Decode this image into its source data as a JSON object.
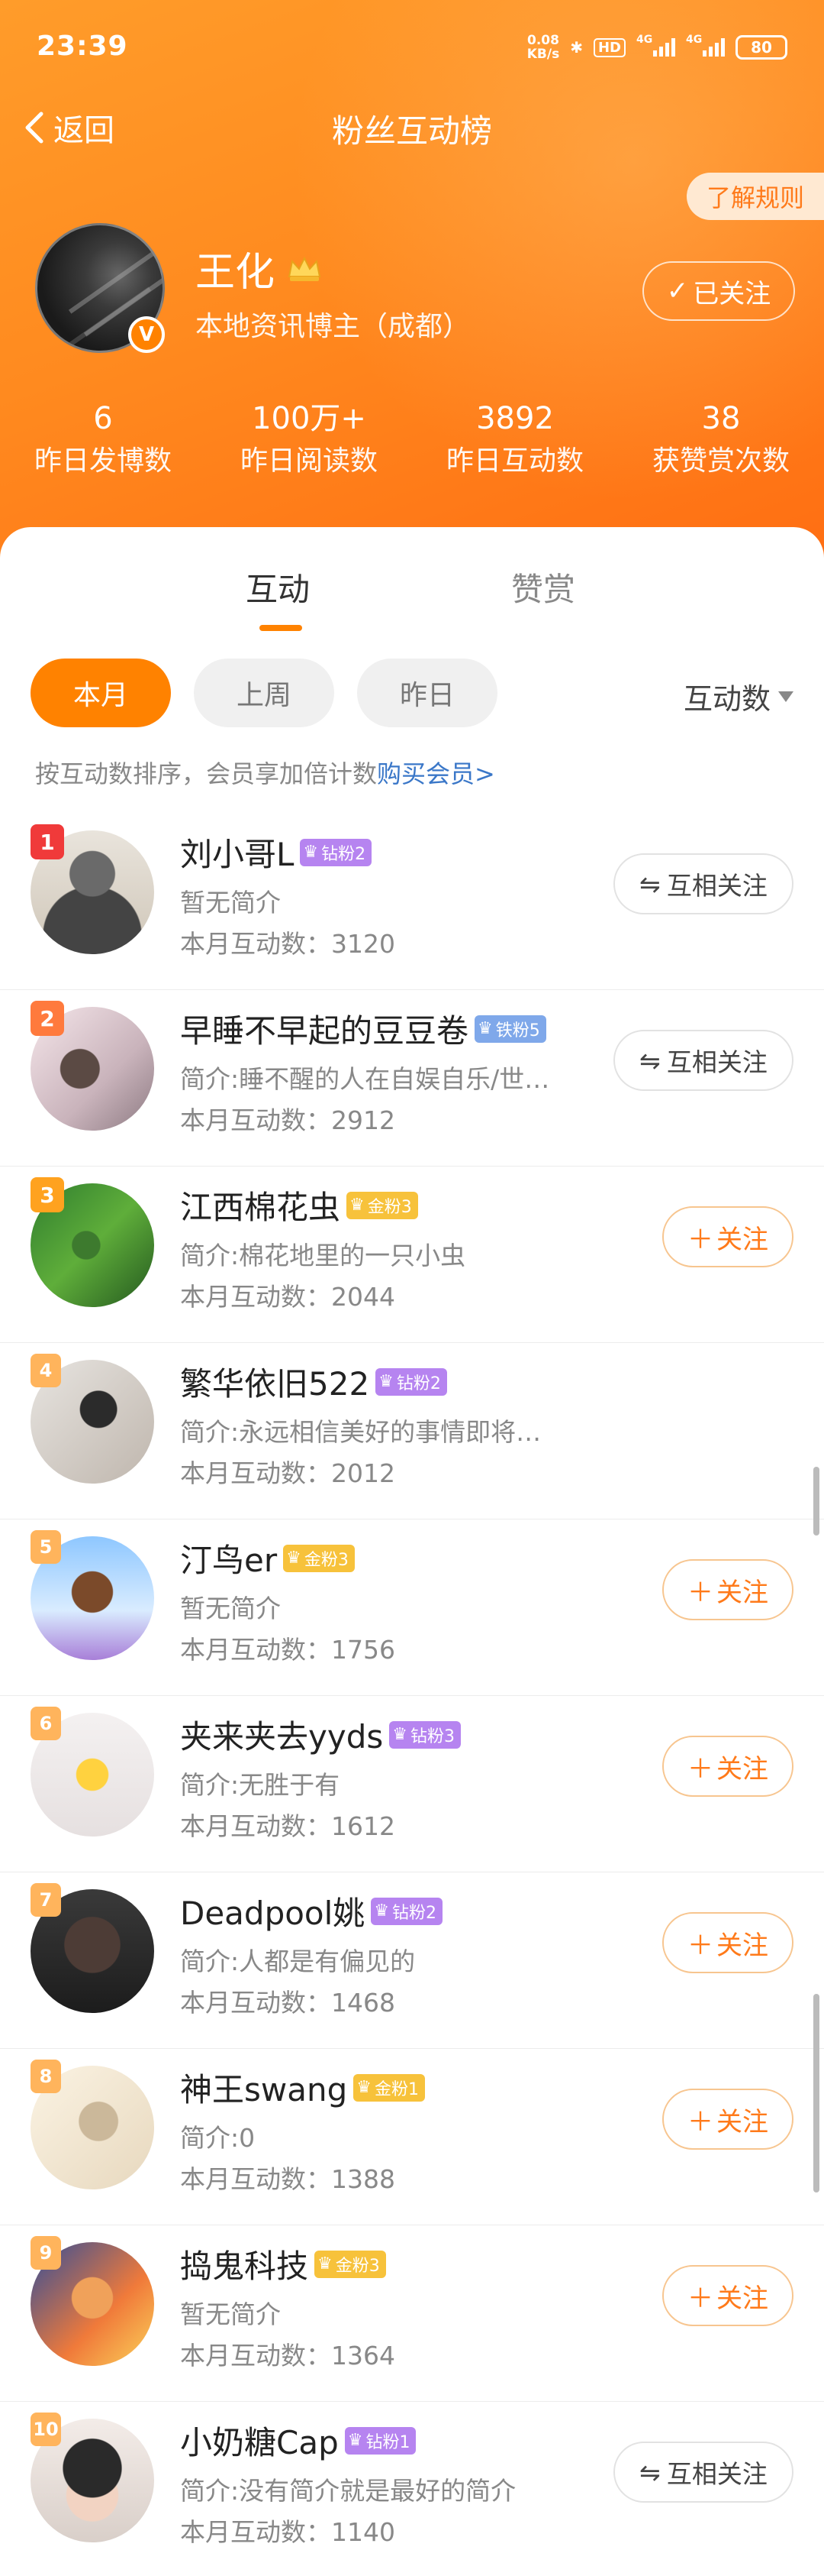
{
  "status_bar": {
    "time": "23:39",
    "net_speed_value": "0.08",
    "net_speed_unit": "KB/s",
    "hd": "HD",
    "sig1": "4G",
    "sig2": "4G",
    "battery": "80"
  },
  "nav": {
    "back_label": "返回",
    "title": "粉丝互动榜"
  },
  "rules_button": "了解规则",
  "profile": {
    "name": "王化",
    "description": "本地资讯博主（成都）",
    "follow_status": "已关注",
    "verified_mark": "V"
  },
  "stats": [
    {
      "value": "6",
      "label": "昨日发博数"
    },
    {
      "value": "100万+",
      "label": "昨日阅读数"
    },
    {
      "value": "3892",
      "label": "昨日互动数"
    },
    {
      "value": "38",
      "label": "获赞赏次数"
    }
  ],
  "tabs": [
    {
      "label": "互动",
      "active": true
    },
    {
      "label": "赞赏",
      "active": false
    }
  ],
  "filters": [
    {
      "label": "本月",
      "active": true
    },
    {
      "label": "上周",
      "active": false
    },
    {
      "label": "昨日",
      "active": false
    }
  ],
  "sort_label": "互动数",
  "hint": {
    "text": "按互动数排序，会员享加倍计数",
    "link": "购买会员>"
  },
  "colors": {
    "accent": "#ff8200",
    "header_gradient_start": "#ff9c2a",
    "header_gradient_end": "#ff6d12",
    "link": "#3a77c8",
    "fan_diamond": "#b684f0",
    "fan_iron": "#7fa8ea",
    "fan_gold": "#f7c23b"
  },
  "fans": [
    {
      "rank": "1",
      "name": "刘小哥L",
      "badge": "钻粉2",
      "badge_type": "zuan",
      "bio": "暂无简介",
      "count": "本月互动数：3120",
      "button": "互相关注",
      "button_type": "mutual"
    },
    {
      "rank": "2",
      "name": "早睡不早起的豆豆卷",
      "badge": "铁粉5",
      "badge_type": "tie",
      "bio": "简介:睡不醒的人在自娱自乐/世…",
      "count": "本月互动数：2912",
      "button": "互相关注",
      "button_type": "mutual"
    },
    {
      "rank": "3",
      "name": "江西棉花虫",
      "badge": "金粉3",
      "badge_type": "jin",
      "bio": "简介:棉花地里的一只小虫",
      "count": "本月互动数：2044",
      "button": "关注",
      "button_type": "follow"
    },
    {
      "rank": "4",
      "name": "繁华依旧522",
      "badge": "钻粉2",
      "badge_type": "zuan",
      "bio": "简介:永远相信美好的事情即将…",
      "count": "本月互动数：2012",
      "button": "",
      "button_type": "none"
    },
    {
      "rank": "5",
      "name": "汀鸟er",
      "badge": "金粉3",
      "badge_type": "jin",
      "bio": "暂无简介",
      "count": "本月互动数：1756",
      "button": "关注",
      "button_type": "follow"
    },
    {
      "rank": "6",
      "name": "夹来夹去yyds",
      "badge": "钻粉3",
      "badge_type": "zuan",
      "bio": "简介:无胜于有",
      "count": "本月互动数：1612",
      "button": "关注",
      "button_type": "follow"
    },
    {
      "rank": "7",
      "name": "Deadpool姚",
      "badge": "钻粉2",
      "badge_type": "zuan",
      "bio": "简介:人都是有偏见的",
      "count": "本月互动数：1468",
      "button": "关注",
      "button_type": "follow"
    },
    {
      "rank": "8",
      "name": "神王swang",
      "badge": "金粉1",
      "badge_type": "jin",
      "bio": "简介:0",
      "count": "本月互动数：1388",
      "button": "关注",
      "button_type": "follow"
    },
    {
      "rank": "9",
      "name": "捣鬼科技",
      "badge": "金粉3",
      "badge_type": "jin",
      "bio": "暂无简介",
      "count": "本月互动数：1364",
      "button": "关注",
      "button_type": "follow"
    },
    {
      "rank": "10",
      "name": "小奶糖Cap",
      "badge": "钻粉1",
      "badge_type": "zuan",
      "bio": "简介:没有简介就是最好的简介",
      "count": "本月互动数：1140",
      "button": "互相关注",
      "button_type": "mutual"
    }
  ]
}
